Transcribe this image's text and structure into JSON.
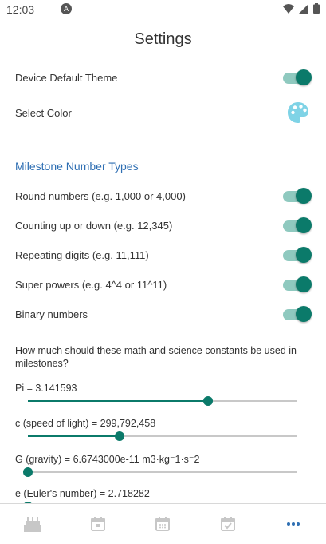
{
  "status_bar": {
    "time": "12:03"
  },
  "page": {
    "title": "Settings"
  },
  "settings": {
    "device_theme_label": "Device Default Theme",
    "select_color_label": "Select Color"
  },
  "milestones": {
    "section_title": "Milestone Number Types",
    "types": [
      {
        "label": "Round numbers (e.g. 1,000 or 4,000)",
        "enabled": true
      },
      {
        "label": "Counting up or down (e.g. 12,345)",
        "enabled": true
      },
      {
        "label": "Repeating digits (e.g. 11,111)",
        "enabled": true
      },
      {
        "label": "Super powers (e.g. 4^4 or 11^11)",
        "enabled": true
      },
      {
        "label": "Binary numbers",
        "enabled": true
      }
    ]
  },
  "constants": {
    "question": "How much should these math and science constants be used in milestones?",
    "items": [
      {
        "label": "Pi = 3.141593",
        "level": 0.67
      },
      {
        "label": "c (speed of light) = 299,792,458",
        "level": 0.34
      },
      {
        "label": "G (gravity) = 6.6743000e-11 m3·kg⁻1·s⁻2",
        "level": 0.0
      },
      {
        "label": "e (Euler's number) = 2.718282",
        "level": 0.0
      }
    ]
  },
  "accent_color": "#0b7a6a",
  "bottom_nav": [
    "cake-icon",
    "calendar-icon",
    "calendar-grid-icon",
    "calendar-check-icon",
    "more-icon"
  ]
}
